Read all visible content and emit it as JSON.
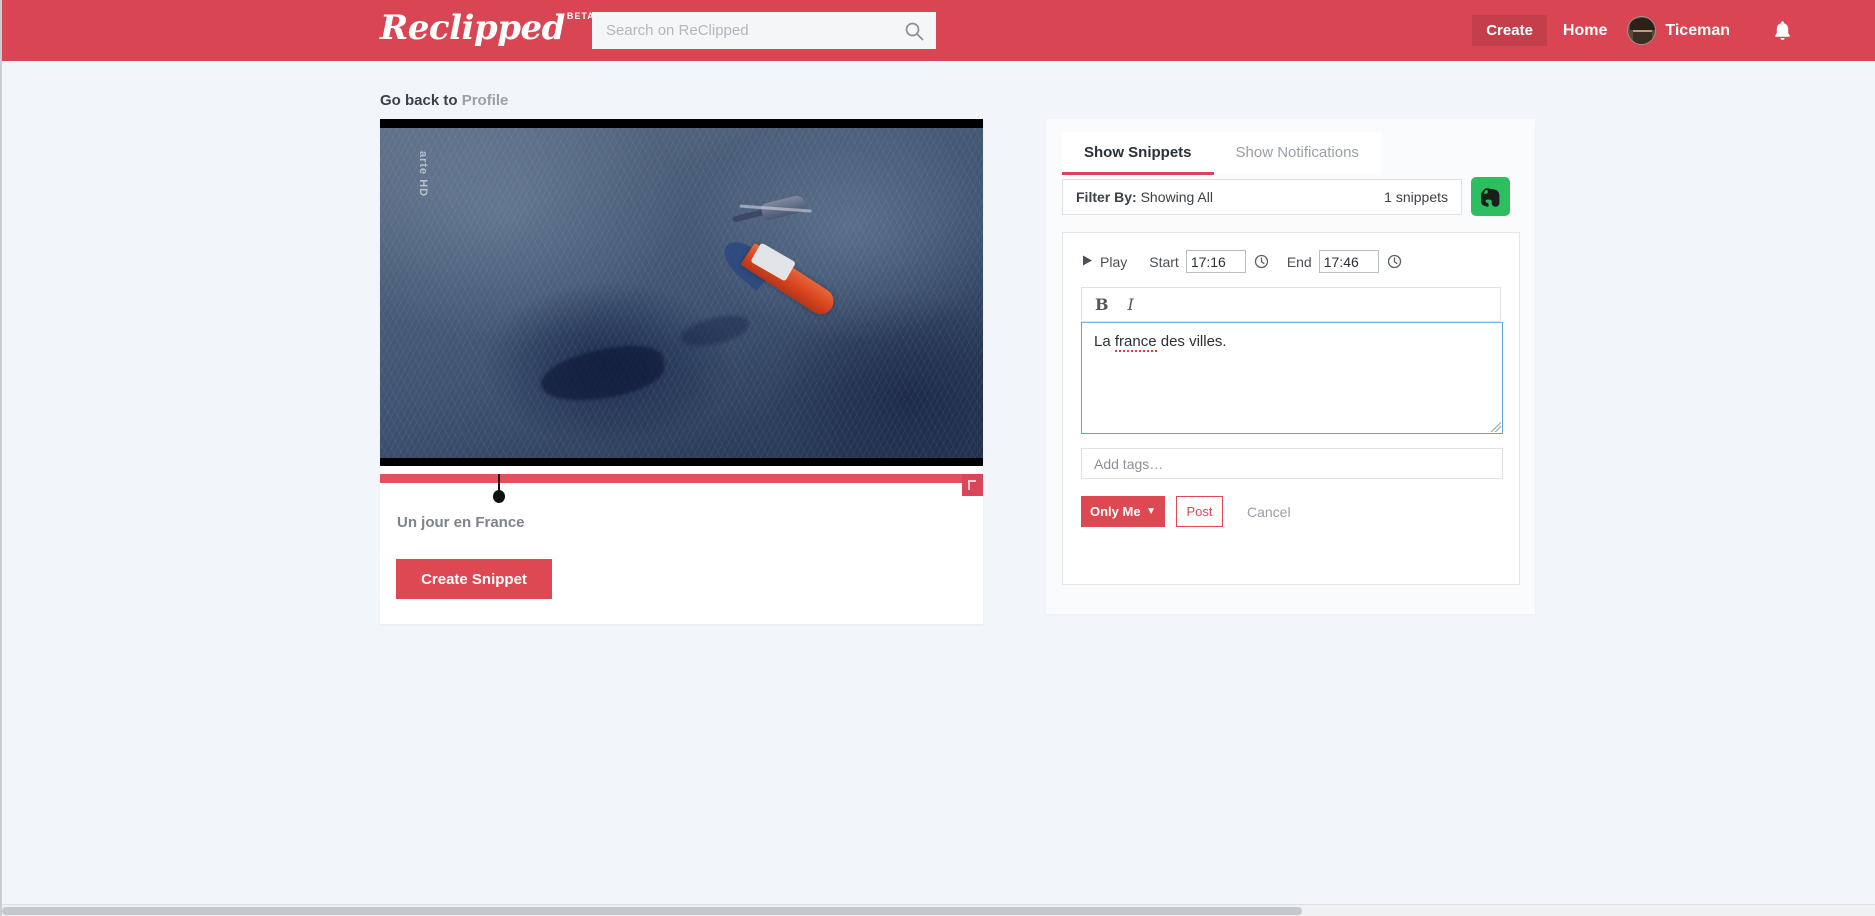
{
  "header": {
    "logo_text": "Reclipped",
    "logo_badge": "BETA",
    "search_placeholder": "Search on ReClipped",
    "search_value": "",
    "search_icon": "search-icon",
    "create_label": "Create",
    "home_label": "Home",
    "username": "Ticeman",
    "bell_icon": "bell-icon",
    "brand_color": "#d94552",
    "create_bg": "#c23f4b"
  },
  "breadcrumb": {
    "prefix": "Go back to",
    "link": "Profile"
  },
  "video": {
    "title": "Un jour en France",
    "watermark": "arte HD",
    "create_snippet_label": "Create Snippet",
    "timeline": {
      "marker_icon": "playhead-marker",
      "end_badge_icon": "clip-end-icon"
    }
  },
  "panel": {
    "tabs": [
      {
        "label": "Show Snippets",
        "active": true
      },
      {
        "label": "Show Notifications",
        "active": false
      }
    ],
    "filter": {
      "label": "Filter By:",
      "value": "Showing All",
      "count": "1 snippets"
    },
    "evernote_icon": "evernote-elephant-icon",
    "evernote_color": "#2dbe60"
  },
  "editor": {
    "play_label": "Play",
    "play_icon": "play-icon",
    "start_label": "Start",
    "start_value": "17:16",
    "start_clock_icon": "clock-icon",
    "end_label": "End",
    "end_value": "17:46",
    "end_clock_icon": "clock-icon",
    "bold_label": "B",
    "italic_label": "I",
    "note_text": "La ",
    "note_misspelled": "france",
    "note_rest": " des villes.",
    "tags_placeholder": "Add tags…",
    "tags_value": "",
    "visibility_label": "Only Me",
    "visibility_caret": "▼",
    "post_label": "Post",
    "cancel_label": "Cancel",
    "accent_color": "#dd4853"
  }
}
